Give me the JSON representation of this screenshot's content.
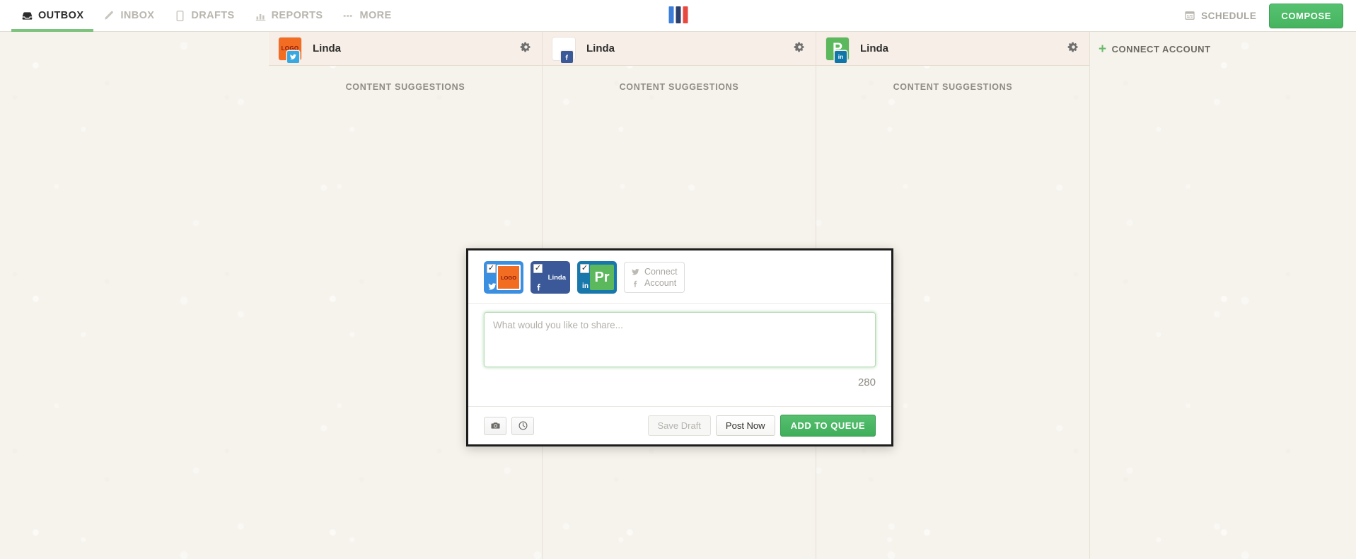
{
  "nav": {
    "items": [
      {
        "label": "OUTBOX",
        "icon": "outbox-icon",
        "active": true
      },
      {
        "label": "INBOX",
        "icon": "pen-icon",
        "active": false
      },
      {
        "label": "DRAFTS",
        "icon": "document-icon",
        "active": false
      },
      {
        "label": "REPORTS",
        "icon": "chart-icon",
        "active": false
      },
      {
        "label": "MORE",
        "icon": "more-icon",
        "active": false
      }
    ],
    "schedule_label": "SCHEDULE",
    "schedule_icon": "calendar-icon",
    "compose_label": "COMPOSE",
    "brand_bars": [
      "#3b7dd8",
      "#2c3e6b",
      "#e8483f"
    ]
  },
  "columns": [
    {
      "name": "Linda",
      "network": "twitter",
      "avatar_kind": "logo-orange",
      "avatar_text": "LOGO",
      "suggestions_label": "CONTENT SUGGESTIONS",
      "gear_icon": "gear-icon"
    },
    {
      "name": "Linda",
      "network": "facebook",
      "avatar_kind": "blank",
      "avatar_text": "",
      "suggestions_label": "CONTENT SUGGESTIONS",
      "gear_icon": "gear-icon"
    },
    {
      "name": "Linda",
      "network": "linkedin",
      "avatar_kind": "green-p",
      "avatar_text": "P",
      "suggestions_label": "CONTENT SUGGESTIONS",
      "gear_icon": "gear-icon"
    }
  ],
  "connect_account": {
    "label": "CONNECT ACCOUNT",
    "plus": "+"
  },
  "compose_modal": {
    "accounts": [
      {
        "network": "twitter",
        "checked": true,
        "check_glyph": "✓",
        "avatar_kind": "orange",
        "avatar_text": "LOGO",
        "label": ""
      },
      {
        "network": "facebook",
        "checked": true,
        "check_glyph": "✓",
        "avatar_kind": "none",
        "avatar_text": "",
        "label": "Linda"
      },
      {
        "network": "linkedin",
        "checked": true,
        "check_glyph": "✓",
        "avatar_kind": "green",
        "avatar_text": "Pr",
        "label": ""
      }
    ],
    "connect_chip": {
      "line1": "Connect",
      "line2": "Account"
    },
    "composer_placeholder": "What would you like to share...",
    "composer_value": "",
    "char_count": "280",
    "attach_photo_icon": "camera-icon",
    "schedule_time_icon": "clock-icon",
    "buttons": {
      "save_draft": "Save Draft",
      "post_now": "Post Now",
      "add_to_queue": "ADD TO QUEUE"
    }
  },
  "colors": {
    "accent_green": "#46b45f",
    "twitter_blue": "#38a8e0",
    "facebook_blue": "#3b5998",
    "linkedin_blue": "#0e76a8",
    "avatar_orange": "#f26c21",
    "page_bg": "#f6f3ec"
  }
}
